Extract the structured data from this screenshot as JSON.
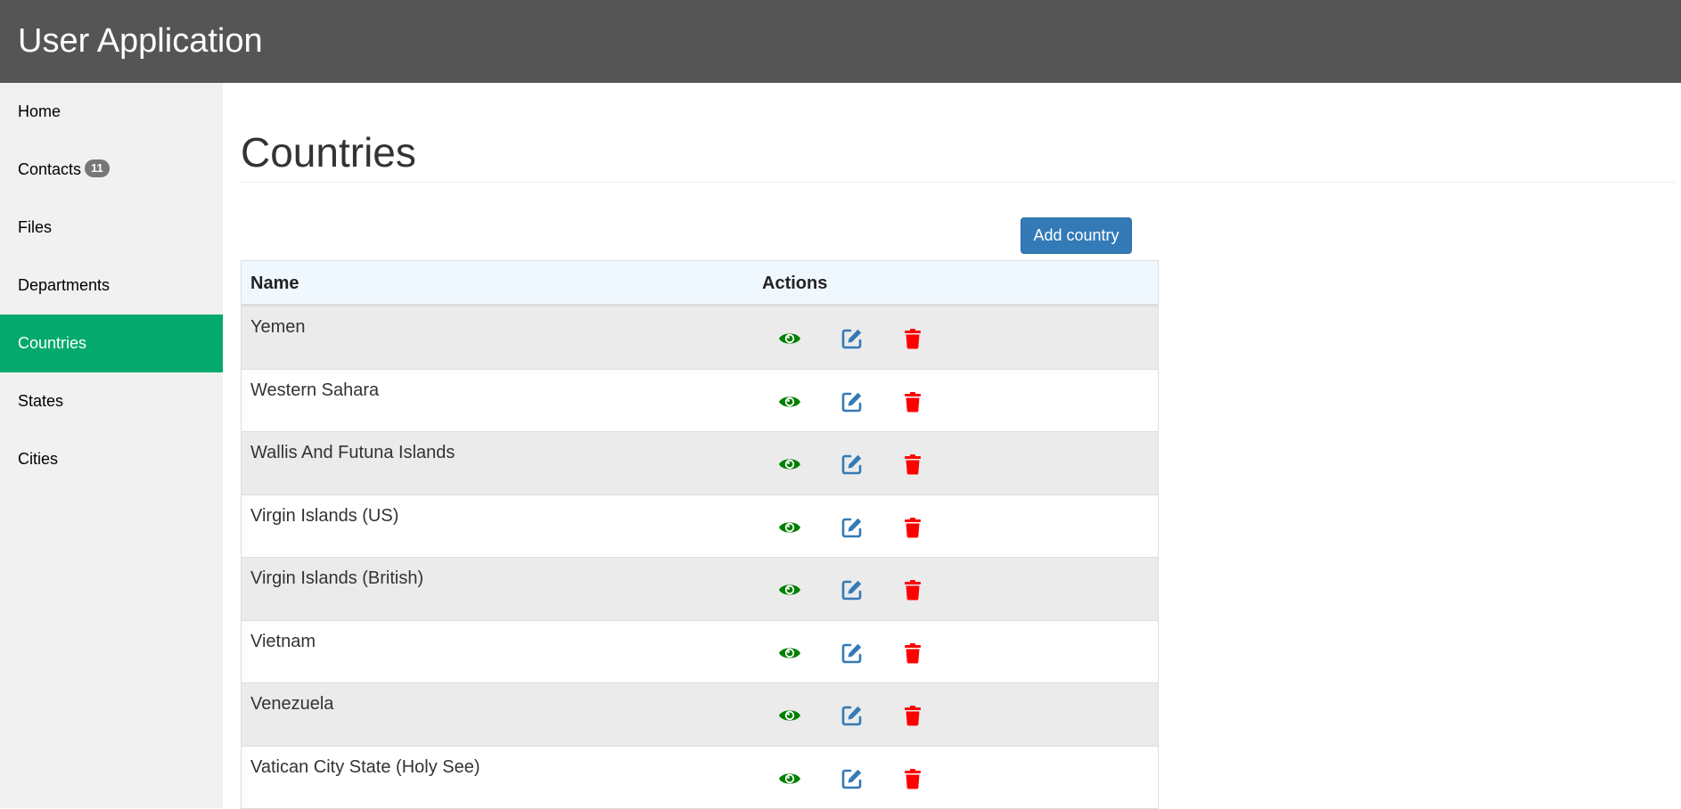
{
  "app": {
    "title": "User Application"
  },
  "sidebar": {
    "items": [
      {
        "label": "Home"
      },
      {
        "label": "Contacts",
        "badge": "11"
      },
      {
        "label": "Files"
      },
      {
        "label": "Departments"
      },
      {
        "label": "Countries",
        "active": true
      },
      {
        "label": "States"
      },
      {
        "label": "Cities"
      }
    ]
  },
  "page": {
    "title": "Countries",
    "add_button": "Add country"
  },
  "table": {
    "headers": {
      "name": "Name",
      "actions": "Actions"
    },
    "rows": [
      {
        "name": "Yemen"
      },
      {
        "name": "Western Sahara"
      },
      {
        "name": "Wallis And Futuna Islands"
      },
      {
        "name": "Virgin Islands (US)"
      },
      {
        "name": "Virgin Islands (British)"
      },
      {
        "name": "Vietnam"
      },
      {
        "name": "Venezuela"
      },
      {
        "name": "Vatican City State (Holy See)"
      }
    ],
    "row_actions": [
      "eye-icon",
      "edit-icon",
      "trash-icon"
    ]
  },
  "colors": {
    "topbar": "#555555",
    "sidebar_active": "#04aa6d",
    "primary_button": "#337ab7",
    "view_icon": "#008000",
    "edit_icon": "#337ab7",
    "delete_icon": "#ff0000"
  }
}
